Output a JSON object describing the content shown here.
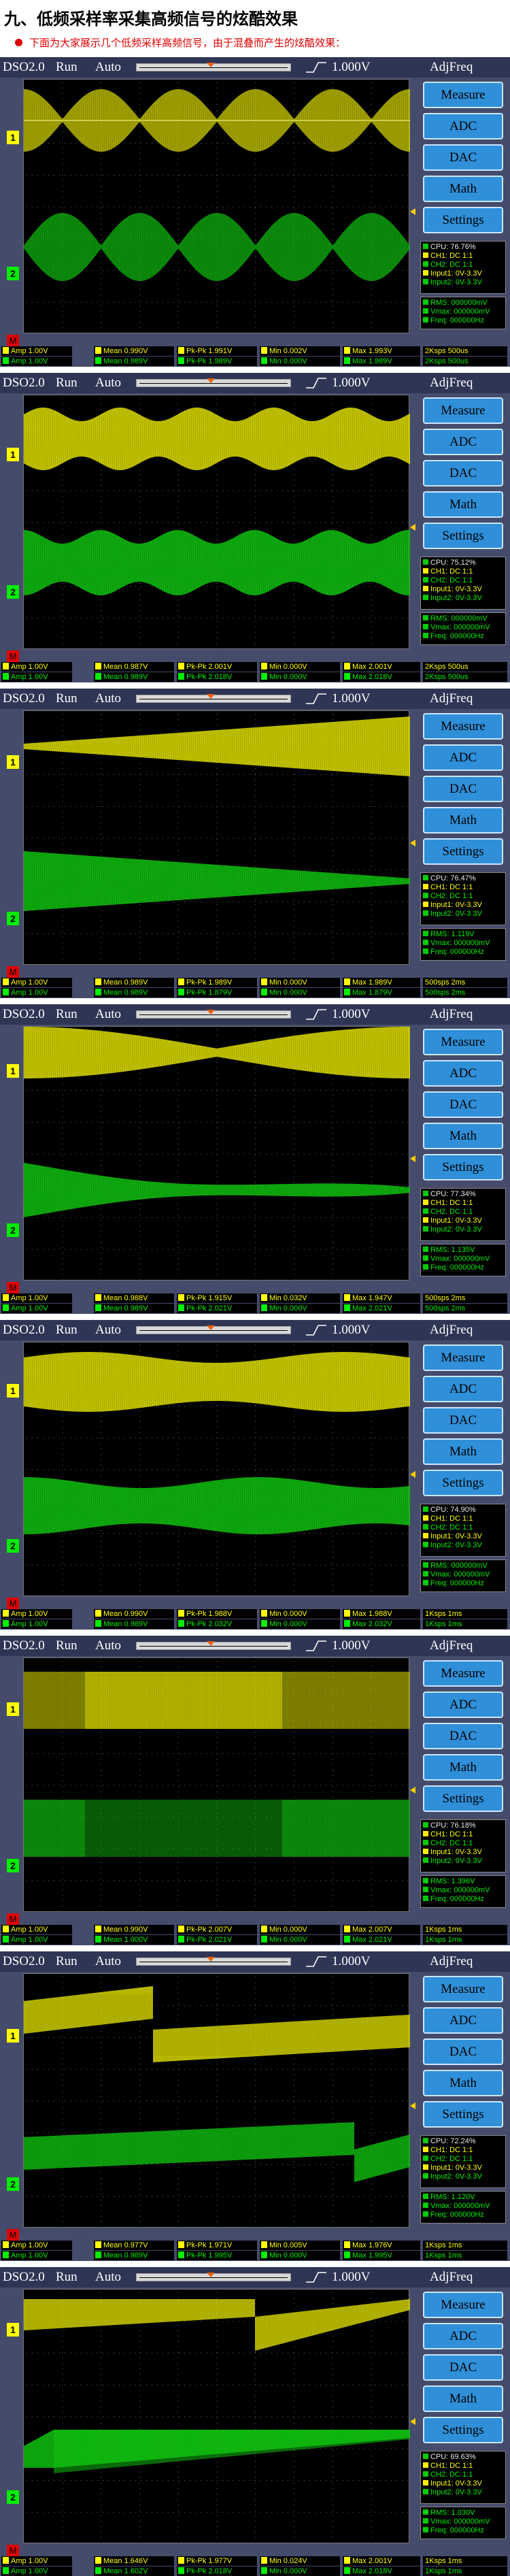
{
  "heading": "九、低频采样率采集高频信号的炫酷效果",
  "intro": "下面为大家展示几个低频采样高频信号，由于混叠而产生的炫酷效果：",
  "scopes": [
    {
      "title": "DSO2.0",
      "run": "Run",
      "mode": "Auto",
      "volt": "1.000V",
      "app": "AdjFreq",
      "buttons": [
        "Measure",
        "ADC",
        "DAC",
        "Math",
        "Settings"
      ],
      "ch1_marker": "1",
      "ch2_marker": "2",
      "m_marker": "M",
      "status": {
        "cpu": "CPU: 76.76%",
        "ch1": "CH1: DC 1:1",
        "ch2": "CH2: DC 1:1",
        "input1": "Input1: 0V-3.3V",
        "input2": "Input2: 0V-3.3V",
        "rms": "RMS: 000000mV",
        "vmax": "Vmax: 000000mV",
        "freq": "Freq: 000000Hz"
      },
      "meas": {
        "ch1": {
          "amp": "Amp    1.00V",
          "mean": "Mean   0.990V",
          "pkpk": "Pk-Pk  1.991V",
          "min": "Min    0.002V",
          "max": "Max    1.993V"
        },
        "ch2": {
          "amp": "Amp    1.00V",
          "mean": "Mean   0.989V",
          "pkpk": "Pk-Pk  1.989V",
          "min": "Min    0.000V",
          "max": "Max    1.989V"
        }
      },
      "timebase": [
        "2Ksps  500us",
        "2Ksps  500us"
      ]
    },
    {
      "title": "DSO2.0",
      "run": "Run",
      "mode": "Auto",
      "volt": "1.000V",
      "app": "AdjFreq",
      "buttons": [
        "Measure",
        "ADC",
        "DAC",
        "Math",
        "Settings"
      ],
      "ch1_marker": "1",
      "ch2_marker": "2",
      "m_marker": "M",
      "status": {
        "cpu": "CPU: 75.12%",
        "ch1": "CH1: DC 1:1",
        "ch2": "CH2: DC 1:1",
        "input1": "Input1: 0V-3.3V",
        "input2": "Input2: 0V-3.3V",
        "rms": "RMS: 000000mV",
        "vmax": "Vmax: 000000mV",
        "freq": "Freq: 000000Hz"
      },
      "meas": {
        "ch1": {
          "amp": "Amp    1.00V",
          "mean": "Mean   0.987V",
          "pkpk": "Pk-Pk  2.001V",
          "min": "Min    0.000V",
          "max": "Max    2.001V"
        },
        "ch2": {
          "amp": "Amp    1.00V",
          "mean": "Mean   0.989V",
          "pkpk": "Pk-Pk  2.018V",
          "min": "Min    0.000V",
          "max": "Max    2.018V"
        }
      },
      "timebase": [
        "2Ksps  500us",
        "2Ksps  500us"
      ]
    },
    {
      "title": "DSO2.0",
      "run": "Run",
      "mode": "Auto",
      "volt": "1.000V",
      "app": "AdjFreq",
      "buttons": [
        "Measure",
        "ADC",
        "DAC",
        "Math",
        "Settings"
      ],
      "ch1_marker": "1",
      "ch2_marker": "2",
      "m_marker": "M",
      "status": {
        "cpu": "CPU: 76.47%",
        "ch1": "CH1: DC 1:1",
        "ch2": "CH2: DC 1:1",
        "input1": "Input1: 0V-3.3V",
        "input2": "Input2: 0V-3.3V",
        "rms": "RMS: 1.119V",
        "vmax": "Vmax: 000000mV",
        "freq": "Freq: 000000Hz"
      },
      "meas": {
        "ch1": {
          "amp": "Amp    1.00V",
          "mean": "Mean   0.989V",
          "pkpk": "Pk-Pk  1.989V",
          "min": "Min    0.000V",
          "max": "Max    1.989V"
        },
        "ch2": {
          "amp": "Amp    1.00V",
          "mean": "Mean   0.989V",
          "pkpk": "Pk-Pk  1.879V",
          "min": "Min    0.000V",
          "max": "Max    1.879V"
        }
      },
      "timebase": [
        "500sps  2ms",
        "500sps  2ms"
      ]
    },
    {
      "title": "DSO2.0",
      "run": "Run",
      "mode": "Auto",
      "volt": "1.000V",
      "app": "AdjFreq",
      "buttons": [
        "Measure",
        "ADC",
        "DAC",
        "Math",
        "Settings"
      ],
      "ch1_marker": "1",
      "ch2_marker": "2",
      "m_marker": "M",
      "status": {
        "cpu": "CPU: 77.34%",
        "ch1": "CH1: DC 1:1",
        "ch2": "CH2: DC 1:1",
        "input1": "Input1: 0V-3.3V",
        "input2": "Input2: 0V-3.3V",
        "rms": "RMS: 1.135V",
        "vmax": "Vmax: 000000mV",
        "freq": "Freq: 000000Hz"
      },
      "meas": {
        "ch1": {
          "amp": "Amp    1.00V",
          "mean": "Mean   0.988V",
          "pkpk": "Pk-Pk  1.915V",
          "min": "Min    0.032V",
          "max": "Max    1.947V"
        },
        "ch2": {
          "amp": "Amp    1.00V",
          "mean": "Mean   0.989V",
          "pkpk": "Pk-Pk  2.021V",
          "min": "Min    0.000V",
          "max": "Max    2.021V"
        }
      },
      "timebase": [
        "500sps  2ms",
        "500sps  2ms"
      ]
    },
    {
      "title": "DSO2.0",
      "run": "Run",
      "mode": "Auto",
      "volt": "1.000V",
      "app": "AdjFreq",
      "buttons": [
        "Measure",
        "ADC",
        "DAC",
        "Math",
        "Settings"
      ],
      "ch1_marker": "1",
      "ch2_marker": "2",
      "m_marker": "M",
      "status": {
        "cpu": "CPU: 74.90%",
        "ch1": "CH1: DC 1:1",
        "ch2": "CH2: DC 1:1",
        "input1": "Input1: 0V-3.3V",
        "input2": "Input2: 0V-3.3V",
        "rms": "RMS: 000000mV",
        "vmax": "Vmax: 000000mV",
        "freq": "Freq: 000000Hz"
      },
      "meas": {
        "ch1": {
          "amp": "Amp    1.00V",
          "mean": "Mean   0.990V",
          "pkpk": "Pk-Pk  1.988V",
          "min": "Min    0.000V",
          "max": "Max    1.988V"
        },
        "ch2": {
          "amp": "Amp    1.00V",
          "mean": "Mean   0.989V",
          "pkpk": "Pk-Pk  2.032V",
          "min": "Min    0.000V",
          "max": "Max    2.032V"
        }
      },
      "timebase": [
        "1Ksps  1ms",
        "1Ksps  1ms"
      ]
    },
    {
      "title": "DSO2.0",
      "run": "Run",
      "mode": "Auto",
      "volt": "1.000V",
      "app": "AdjFreq",
      "buttons": [
        "Measure",
        "ADC",
        "DAC",
        "Math",
        "Settings"
      ],
      "ch1_marker": "1",
      "ch2_marker": "2",
      "m_marker": "M",
      "status": {
        "cpu": "CPU: 76.18%",
        "ch1": "CH1: DC 1:1",
        "ch2": "CH2: DC 1:1",
        "input1": "Input1: 0V-3.3V",
        "input2": "Input2: 0V-3.3V",
        "rms": "RMS: 1.396V",
        "vmax": "Vmax: 000000mV",
        "freq": "Freq: 000000Hz"
      },
      "meas": {
        "ch1": {
          "amp": "Amp    1.00V",
          "mean": "Mean   0.990V",
          "pkpk": "Pk-Pk  2.007V",
          "min": "Min    0.000V",
          "max": "Max    2.007V"
        },
        "ch2": {
          "amp": "Amp    1.00V",
          "mean": "Mean   1.000V",
          "pkpk": "Pk-Pk  2.021V",
          "min": "Min    0.000V",
          "max": "Max    2.021V"
        }
      },
      "timebase": [
        "1Ksps  1ms",
        "1Ksps  1ms"
      ]
    },
    {
      "title": "DSO2.0",
      "run": "Run",
      "mode": "Auto",
      "volt": "1.000V",
      "app": "AdjFreq",
      "buttons": [
        "Measure",
        "ADC",
        "DAC",
        "Math",
        "Settings"
      ],
      "ch1_marker": "1",
      "ch2_marker": "2",
      "m_marker": "M",
      "status": {
        "cpu": "CPU: 72.24%",
        "ch1": "CH1: DC 1:1",
        "ch2": "CH2: DC 1:1",
        "input1": "Input1: 0V-3.3V",
        "input2": "Input2: 0V-3.3V",
        "rms": "RMS: 1.120V",
        "vmax": "Vmax: 000000mV",
        "freq": "Freq: 000000Hz"
      },
      "meas": {
        "ch1": {
          "amp": "Amp    1.00V",
          "mean": "Mean   0.977V",
          "pkpk": "Pk-Pk  1.971V",
          "min": "Min    0.005V",
          "max": "Max    1.976V"
        },
        "ch2": {
          "amp": "Amp    1.00V",
          "mean": "Mean   0.989V",
          "pkpk": "Pk-Pk  1.995V",
          "min": "Min    0.000V",
          "max": "Max    1.995V"
        }
      },
      "timebase": [
        "1Ksps  1ms",
        "1Ksps  1ms"
      ]
    },
    {
      "title": "DSO2.0",
      "run": "Run",
      "mode": "Auto",
      "volt": "1.000V",
      "app": "AdjFreq",
      "buttons": [
        "Measure",
        "ADC",
        "DAC",
        "Math",
        "Settings"
      ],
      "ch1_marker": "1",
      "ch2_marker": "2",
      "m_marker": "M",
      "status": {
        "cpu": "CPU: 69.63%",
        "ch1": "CH1: DC 1:1",
        "ch2": "CH2: DC 1:1",
        "input1": "Input1: 0V-3.3V",
        "input2": "Input2: 0V-3.3V",
        "rms": "RMS: 1.030V",
        "vmax": "Vmax: 000000mV",
        "freq": "Freq: 000000Hz"
      },
      "meas": {
        "ch1": {
          "amp": "Amp    1.00V",
          "mean": "Mean   1.646V",
          "pkpk": "Pk-Pk  1.977V",
          "min": "Min    0.024V",
          "max": "Max    2.001V"
        },
        "ch2": {
          "amp": "Amp    1.00V",
          "mean": "Mean   1.602V",
          "pkpk": "Pk-Pk  2.018V",
          "min": "Min    0.000V",
          "max": "Max    2.018V"
        }
      },
      "timebase": [
        "1Ksps  1ms",
        "1Ksps  1ms"
      ]
    }
  ],
  "colors": {
    "ch1": "#ffff00",
    "ch2": "#00ee00",
    "frame": "#454b6b",
    "button": "#2f8fd8"
  }
}
